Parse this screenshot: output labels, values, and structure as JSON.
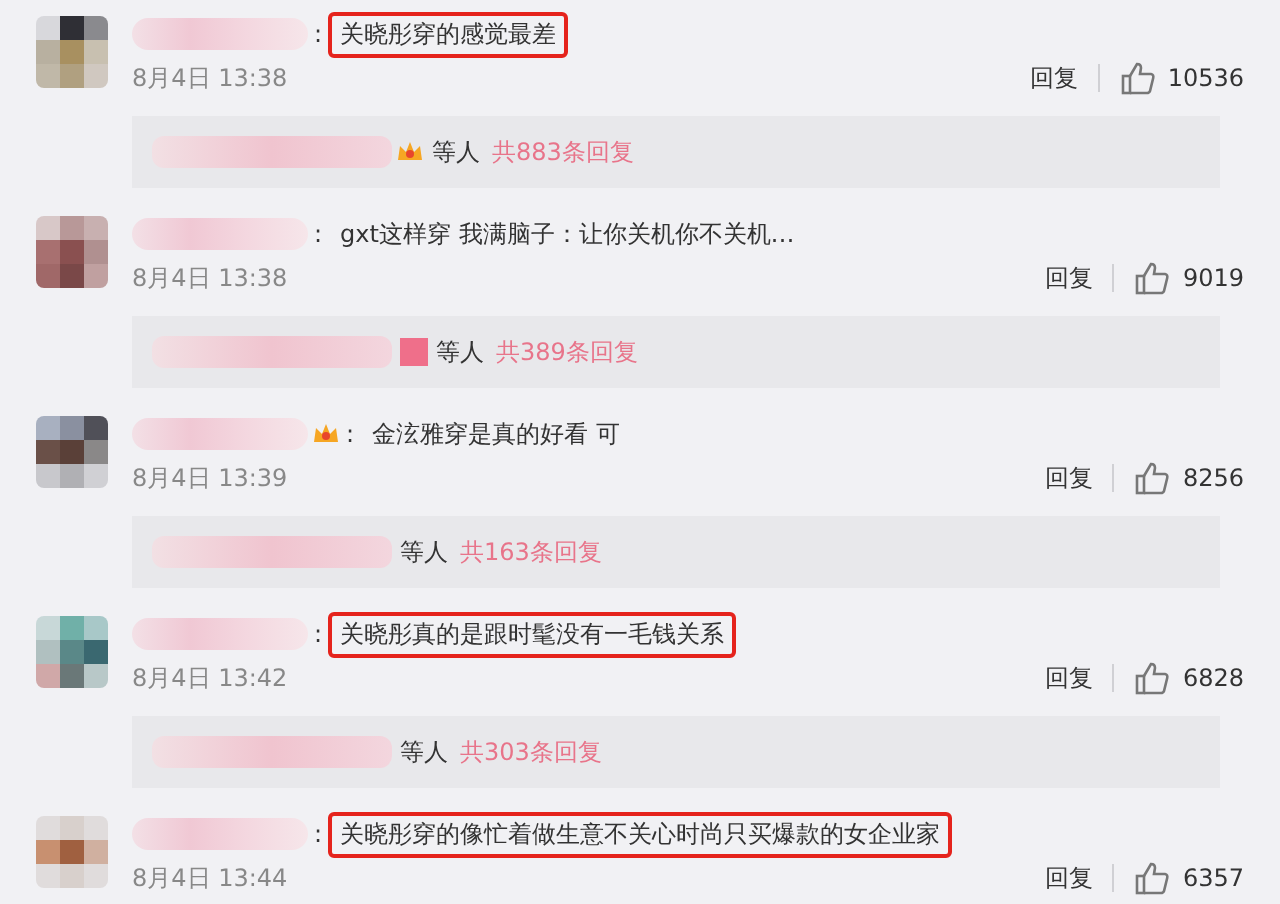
{
  "comments": [
    {
      "separator": ":",
      "text": "关晓彤穿的感觉最差",
      "highlighted": true,
      "name_badge": false,
      "date": "8月4日 13:38",
      "reply_label": "回复",
      "likes": "10536",
      "replies": {
        "badge": true,
        "suffix": "等人",
        "count": "共883条回复"
      }
    },
    {
      "separator": ":",
      "text": "gxt这样穿 我满脑子：让你关机你不关机…",
      "highlighted": false,
      "name_badge": false,
      "date": "8月4日 13:38",
      "reply_label": "回复",
      "likes": "9019",
      "replies": {
        "badge": true,
        "suffix": "等人",
        "count": "共389条回复"
      }
    },
    {
      "separator": ":",
      "text": "金泫雅穿是真的好看 可",
      "highlighted": false,
      "name_badge": true,
      "date": "8月4日 13:39",
      "reply_label": "回复",
      "likes": "8256",
      "replies": {
        "badge": false,
        "suffix": "等人",
        "count": "共163条回复"
      }
    },
    {
      "separator": ":",
      "text": "关晓彤真的是跟时髦没有一毛钱关系",
      "highlighted": true,
      "name_badge": false,
      "date": "8月4日 13:42",
      "reply_label": "回复",
      "likes": "6828",
      "replies": {
        "badge": false,
        "suffix": "等人",
        "count": "共303条回复"
      }
    },
    {
      "separator": ":",
      "text": "关晓彤穿的像忙着做生意不关心时尚只买爆款的女企业家",
      "highlighted": true,
      "name_badge": false,
      "date": "8月4日 13:44",
      "reply_label": "回复",
      "likes": "6357"
    }
  ]
}
